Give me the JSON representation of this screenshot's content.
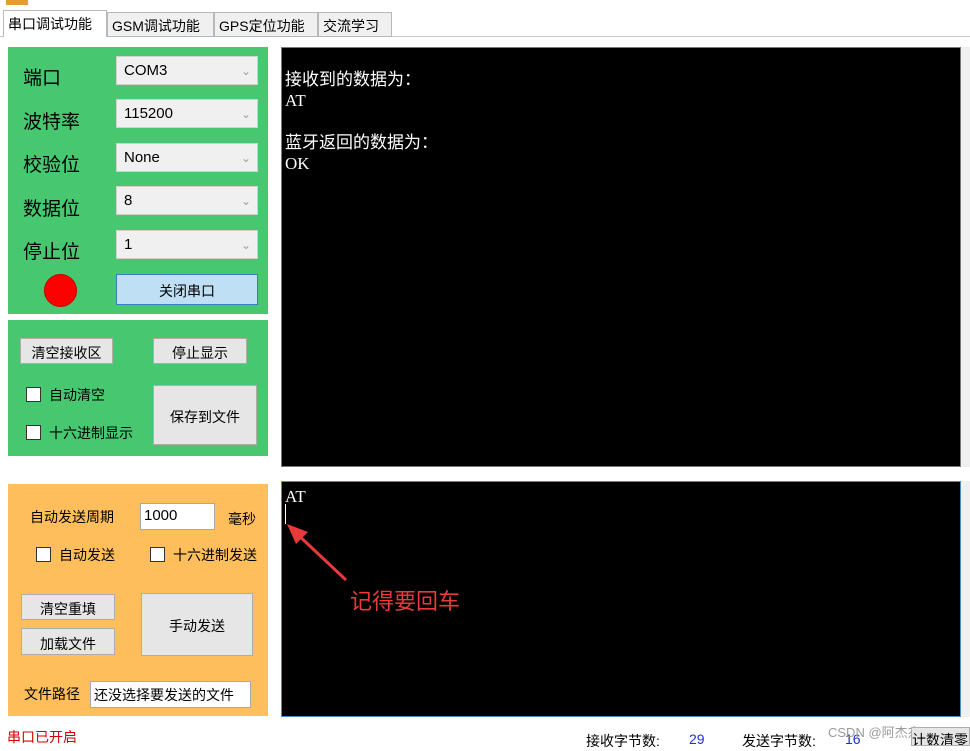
{
  "tabs": [
    "串口调试功能",
    "GSM调试功能",
    "GPS定位功能",
    "交流学习"
  ],
  "serial": {
    "port_label": "端口",
    "port_value": "COM3",
    "baud_label": "波特率",
    "baud_value": "115200",
    "parity_label": "校验位",
    "parity_value": "None",
    "databits_label": "数据位",
    "databits_value": "8",
    "stopbits_label": "停止位",
    "stopbits_value": "1",
    "close_button": "关闭串口",
    "status_color": "#ff0000"
  },
  "receive_controls": {
    "clear_button": "清空接收区",
    "stop_button": "停止显示",
    "auto_clear_label": "自动清空",
    "hex_display_label": "十六进制显示",
    "save_button": "保存到文件"
  },
  "receive_area": {
    "lines": [
      "接收到的数据为：",
      "AT",
      "",
      "蓝牙返回的数据为：",
      "OK"
    ]
  },
  "send_controls": {
    "period_label": "自动发送周期",
    "period_value": "1000",
    "unit_label": "毫秒",
    "auto_send_label": "自动发送",
    "hex_send_label": "十六进制发送",
    "clear_refill_button": "清空重填",
    "load_file_button": "加载文件",
    "manual_send_button": "手动发送",
    "path_label": "文件路径",
    "path_value": "还没选择要发送的文件"
  },
  "send_area": {
    "text": "AT",
    "annotation": "记得要回车"
  },
  "status_bar": {
    "port_status": "串口已开启",
    "rx_label": "接收字节数:",
    "rx_value": "29",
    "tx_label": "发送字节数:",
    "tx_value": "16",
    "clear_count_button": "计数清零",
    "watermark": "CSDN @阿杰杰"
  },
  "colors": {
    "green_panel": "#47c870",
    "orange_panel": "#ffbe5c",
    "annotation": "#e83a3a",
    "count_value": "#1a35c8",
    "port_status": "#d40000"
  }
}
